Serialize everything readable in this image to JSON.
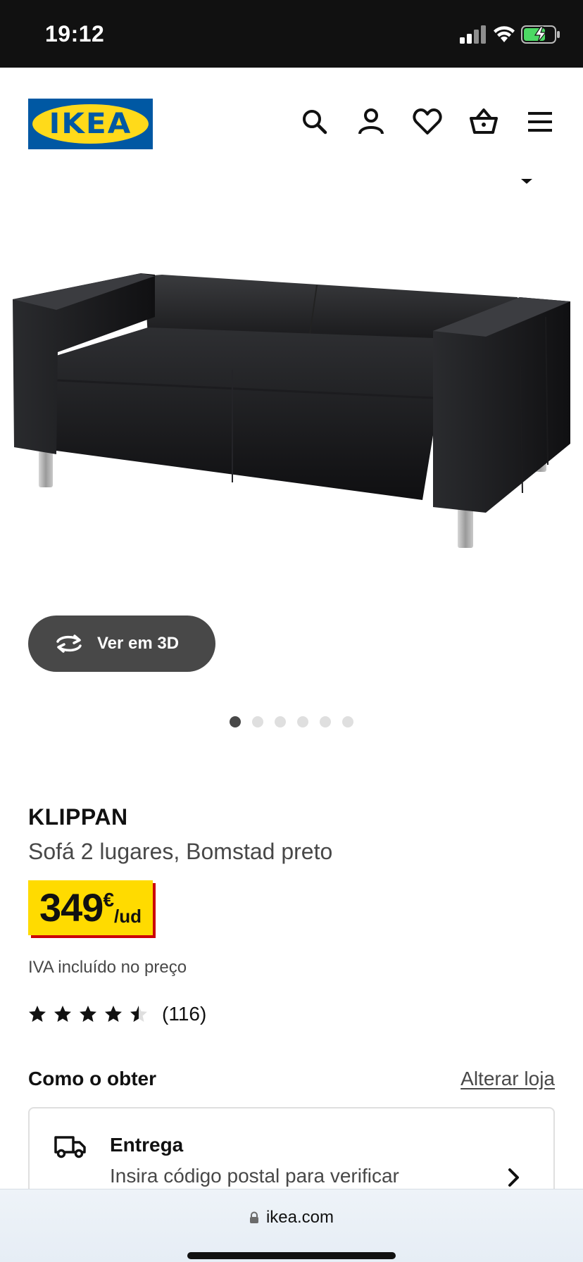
{
  "status_bar": {
    "time": "19:12",
    "icons": [
      "signal-icon",
      "wifi-icon",
      "battery-charging-icon"
    ],
    "battery_color": "#4cd964"
  },
  "header": {
    "logo_text": "IKEA",
    "logo_colors": {
      "blue": "#0058a3",
      "yellow": "#ffda1a"
    },
    "icons": [
      "search-icon",
      "account-icon",
      "wishlist-heart-icon",
      "shopping-basket-icon",
      "menu-icon"
    ]
  },
  "gallery": {
    "view_3d_label": "Ver em 3D",
    "dots_total": 6,
    "active_dot": 1
  },
  "product": {
    "name": "KLIPPAN",
    "description": "Sofá 2 lugares, Bomstad preto",
    "price": {
      "integer": "349",
      "currency": "€",
      "unit": "/ud"
    },
    "vat_note": "IVA incluído no preço",
    "rating": {
      "stars": 4.5,
      "max": 5,
      "count_text": "(116)"
    }
  },
  "obtain": {
    "title": "Como o obter",
    "change_store_label": "Alterar loja",
    "delivery": {
      "title": "Entrega",
      "subtitle": "Insira código postal para verificar"
    }
  },
  "browser": {
    "url": "ikea.com"
  },
  "colors": {
    "price_yellow": "#ffdb00",
    "price_red": "#cc0008",
    "button_dark": "#484848"
  }
}
